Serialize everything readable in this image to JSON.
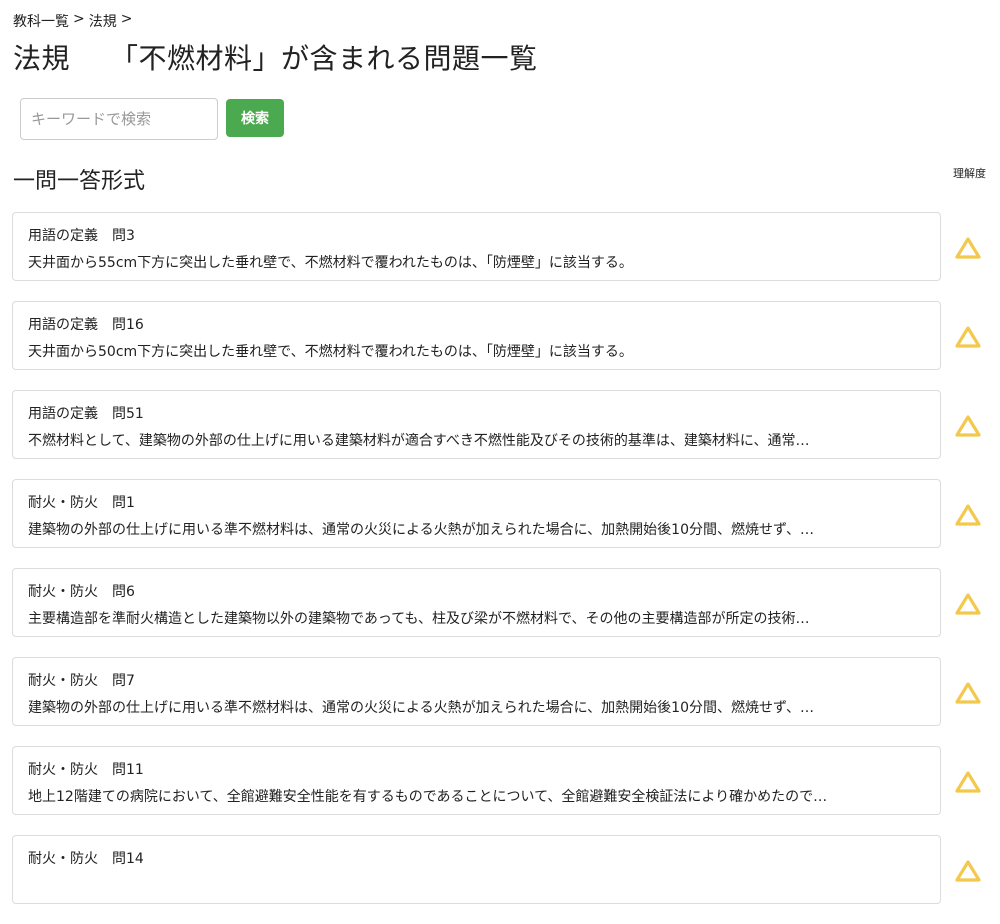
{
  "breadcrumb": {
    "items": [
      "教科一覧",
      "法規"
    ],
    "separator": ">"
  },
  "page": {
    "subject": "法規",
    "title": "「不燃材料」が含まれる問題一覧"
  },
  "search": {
    "placeholder": "キーワードで検索",
    "value": "",
    "button_label": "検索"
  },
  "section": {
    "title": "一問一答形式",
    "comprehension_header": "理解度"
  },
  "colors": {
    "accent": "#4ba94f",
    "level_triangle": "#f2c94c"
  },
  "questions": [
    {
      "category": "用語の定義",
      "number": "問3",
      "text": "天井面から55cm下方に突出した垂れ壁で、不燃材料で覆われたものは、「防煙壁」に該当する。",
      "level_icon": "triangle-icon"
    },
    {
      "category": "用語の定義",
      "number": "問16",
      "text": "天井面から50cm下方に突出した垂れ壁で、不燃材料で覆われたものは、「防煙壁」に該当する。",
      "level_icon": "triangle-icon"
    },
    {
      "category": "用語の定義",
      "number": "問51",
      "text": "不燃材料として、建築物の外部の仕上げに用いる建築材料が適合すべき不燃性能及びその技術的基準は、建築材料に、通常…",
      "level_icon": "triangle-icon"
    },
    {
      "category": "耐火・防火",
      "number": "問1",
      "text": "建築物の外部の仕上げに用いる準不燃材料は、通常の火災による火熱が加えられた場合に、加熱開始後10分間、燃焼せず、…",
      "level_icon": "triangle-icon"
    },
    {
      "category": "耐火・防火",
      "number": "問6",
      "text": "主要構造部を準耐火構造とした建築物以外の建築物であっても、柱及び梁が不燃材料で、その他の主要構造部が所定の技術…",
      "level_icon": "triangle-icon"
    },
    {
      "category": "耐火・防火",
      "number": "問7",
      "text": "建築物の外部の仕上げに用いる準不燃材料は、通常の火災による火熱が加えられた場合に、加熱開始後10分間、燃焼せず、…",
      "level_icon": "triangle-icon"
    },
    {
      "category": "耐火・防火",
      "number": "問11",
      "text": "地上12階建ての病院において、全館避難安全性能を有するものであることについて、全館避難安全検証法により確かめたので…",
      "level_icon": "triangle-icon"
    },
    {
      "category": "耐火・防火",
      "number": "問14",
      "text": "",
      "level_icon": "triangle-icon"
    }
  ]
}
